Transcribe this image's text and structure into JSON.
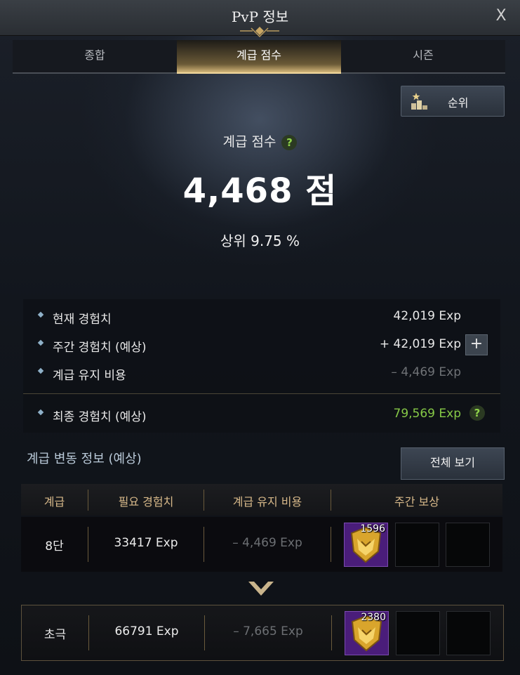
{
  "window": {
    "title": "PvP 정보",
    "close_label": "X"
  },
  "tabs": [
    {
      "label": "종합",
      "active": false
    },
    {
      "label": "계급 점수",
      "active": true
    },
    {
      "label": "시즌",
      "active": false
    }
  ],
  "rank_button": {
    "label": "순위",
    "icon": "ranking-podium-icon"
  },
  "score": {
    "title": "계급 점수",
    "help": "?",
    "value": "4,468 점",
    "percentile": "상위 9.75 %"
  },
  "exp": {
    "rows": [
      {
        "label": "현재 경험치",
        "value": "42,019 Exp"
      },
      {
        "label": "주간 경험치 (예상)",
        "value": "+ 42,019 Exp",
        "action": "+"
      },
      {
        "label": "계급 유지 비용",
        "value": "– 4,469 Exp"
      }
    ],
    "final": {
      "label": "최종 경험치 (예상)",
      "value": "79,569 Exp",
      "help": "?"
    }
  },
  "tier_section": {
    "title": "계급 변동 정보 (예상)",
    "view_all": "전체 보기",
    "headers": [
      "계급",
      "필요 경험치",
      "계급 유지 비용",
      "주간 보상"
    ],
    "rows": [
      {
        "tier": "8단",
        "required_exp": "33417 Exp",
        "maintenance": "– 4,469 Exp",
        "reward_count": "1596"
      },
      {
        "tier": "초극",
        "required_exp": "66791 Exp",
        "maintenance": "– 7,665 Exp",
        "reward_count": "2380"
      }
    ]
  },
  "colors": {
    "accent_gold": "#d4b77a",
    "green": "#86c947",
    "reward_purple": "#4a1d7a"
  }
}
